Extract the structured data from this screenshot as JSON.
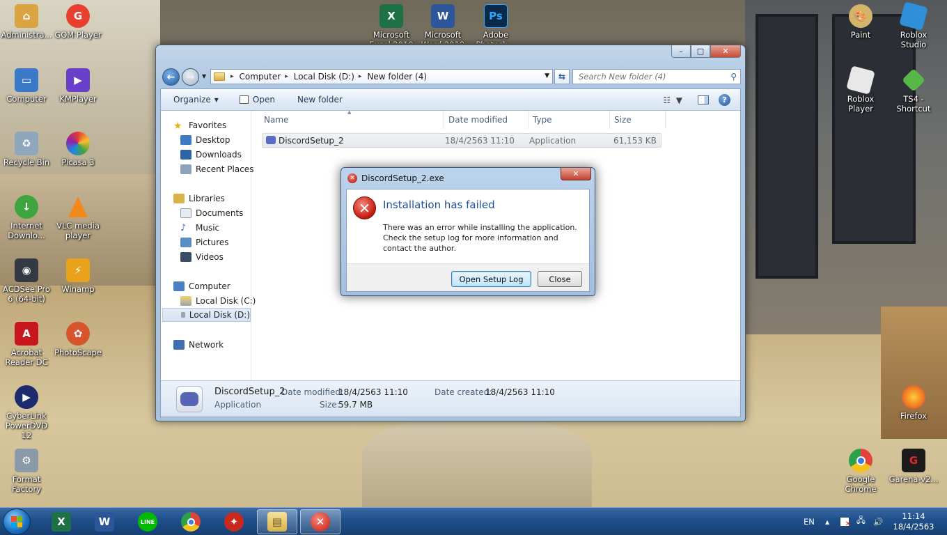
{
  "desktop": {
    "left_icons": [
      {
        "label": "Administra...",
        "icon": "user-folder-icon",
        "color": "#d9a441"
      },
      {
        "label": "GOM Player",
        "icon": "gom-player-icon",
        "color": "#e8402e"
      },
      {
        "label": "Computer",
        "icon": "computer-icon",
        "color": "#3a78c8"
      },
      {
        "label": "KMPlayer",
        "icon": "kmplayer-icon",
        "color": "#6a3fc9"
      },
      {
        "label": "Recycle Bin",
        "icon": "recycle-bin-icon",
        "color": "#8fa7bd"
      },
      {
        "label": "Picasa 3",
        "icon": "picasa-icon",
        "color": "#d84a8a"
      },
      {
        "label": "Internet Downlo...",
        "icon": "idm-icon",
        "color": "#3ea43e"
      },
      {
        "label": "VLC media player",
        "icon": "vlc-icon",
        "color": "#f08a1c"
      },
      {
        "label": "ACDSee Pro 6 (64-bit)",
        "icon": "acdsee-icon",
        "color": "#333a44"
      },
      {
        "label": "Winamp",
        "icon": "winamp-icon",
        "color": "#e9a21c"
      },
      {
        "label": "Acrobat Reader DC",
        "icon": "acrobat-icon",
        "color": "#c8161d"
      },
      {
        "label": "PhotoScape",
        "icon": "photoscape-icon",
        "color": "#d8542c"
      },
      {
        "label": "CyberLink PowerDVD 12",
        "icon": "powerdvd-icon",
        "color": "#1e2a6e"
      },
      {
        "label": "Format Factory",
        "icon": "format-factory-icon",
        "color": "#8a9aa8"
      }
    ],
    "top_icons": [
      {
        "label": "Microsoft Excel 2010",
        "icon": "excel-icon",
        "color": "#1e7145",
        "glyph": "X"
      },
      {
        "label": "Microsoft Word 2010",
        "icon": "word-icon",
        "color": "#2b579a",
        "glyph": "W"
      },
      {
        "label": "Adobe Photosh...",
        "icon": "photoshop-icon",
        "color": "#0b2a4a",
        "glyph": "Ps"
      }
    ],
    "right_icons": [
      {
        "label": "Paint",
        "icon": "paint-icon",
        "color": "#d3b46a"
      },
      {
        "label": "Roblox Studio",
        "icon": "roblox-studio-icon",
        "color": "#2f8fd8"
      },
      {
        "label": "Roblox Player",
        "icon": "roblox-player-icon",
        "color": "#e8e8e8"
      },
      {
        "label": "TS4 - Shortcut",
        "icon": "sims4-icon",
        "color": "#56b947"
      },
      {
        "label": "Firefox",
        "icon": "firefox-icon",
        "color": "#f0761d"
      },
      {
        "label": "Google Chrome",
        "icon": "chrome-icon",
        "color": "#e0443a"
      },
      {
        "label": "Garena-v2...",
        "icon": "garena-icon",
        "color": "#c3191f"
      }
    ]
  },
  "explorer": {
    "caption": {
      "minimize": "–",
      "maximize": "□",
      "close": "✕"
    },
    "breadcrumbs": [
      "Computer",
      "Local Disk (D:)",
      "New folder (4)"
    ],
    "search_placeholder": "Search New folder (4)",
    "toolbar": {
      "organize": "Organize",
      "open": "Open",
      "new_folder": "New folder"
    },
    "nav": {
      "favorites": "Favorites",
      "desktop": "Desktop",
      "downloads": "Downloads",
      "recent": "Recent Places",
      "libraries": "Libraries",
      "documents": "Documents",
      "music": "Music",
      "pictures": "Pictures",
      "videos": "Videos",
      "computer": "Computer",
      "disk_c": "Local Disk (C:)",
      "disk_d": "Local Disk (D:)",
      "network": "Network"
    },
    "columns": {
      "name": "Name",
      "date": "Date modified",
      "type": "Type",
      "size": "Size"
    },
    "file": {
      "name": "DiscordSetup_2",
      "date": "18/4/2563 11:10",
      "type": "Application",
      "size": "61,153 KB"
    },
    "details": {
      "name": "DiscordSetup_2",
      "kind": "Application",
      "date_modified_label": "Date modified:",
      "date_modified": "18/4/2563 11:10",
      "size_label": "Size:",
      "size": "59.7 MB",
      "date_created_label": "Date created:",
      "date_created": "18/4/2563 11:10"
    }
  },
  "dialog": {
    "title": "DiscordSetup_2.exe",
    "heading": "Installation has failed",
    "message": "There was an error while installing the application. Check the setup log for more information and contact the author.",
    "open_log": "Open Setup Log",
    "close": "Close",
    "close_glyph": "✕"
  },
  "taskbar": {
    "apps": [
      {
        "name": "excel",
        "glyph": "X",
        "color": "#1e7145"
      },
      {
        "name": "word",
        "glyph": "W",
        "color": "#2b579a"
      },
      {
        "name": "line",
        "glyph": "LINE",
        "color": "#00b900"
      },
      {
        "name": "chrome",
        "glyph": "●",
        "color": "#db4437"
      },
      {
        "name": "game",
        "glyph": "✦",
        "color": "#c8281e"
      },
      {
        "name": "explorer",
        "glyph": "▤",
        "color": "#e2b84a"
      },
      {
        "name": "error-dialog",
        "glyph": "✕",
        "color": "#c8180e"
      }
    ],
    "language": "EN",
    "time": "11:14",
    "date": "18/4/2563"
  }
}
